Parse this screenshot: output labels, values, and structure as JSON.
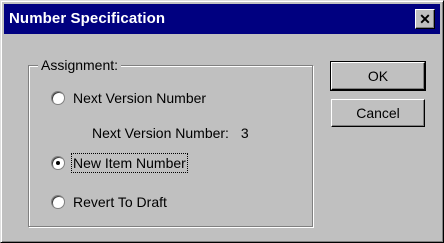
{
  "window": {
    "title": "Number Specification",
    "close_glyph": "✕"
  },
  "group": {
    "label": "Assignment:"
  },
  "options": [
    {
      "label": "Next Version Number",
      "checked": false
    },
    {
      "label": "New Item Number",
      "checked": true
    },
    {
      "label": "Revert To Draft",
      "checked": false
    }
  ],
  "next_version": {
    "label": "Next Version Number:",
    "value": "3"
  },
  "buttons": {
    "ok": "OK",
    "cancel": "Cancel"
  },
  "colors": {
    "titlebar": "#000080",
    "face": "#c0c0c0"
  }
}
